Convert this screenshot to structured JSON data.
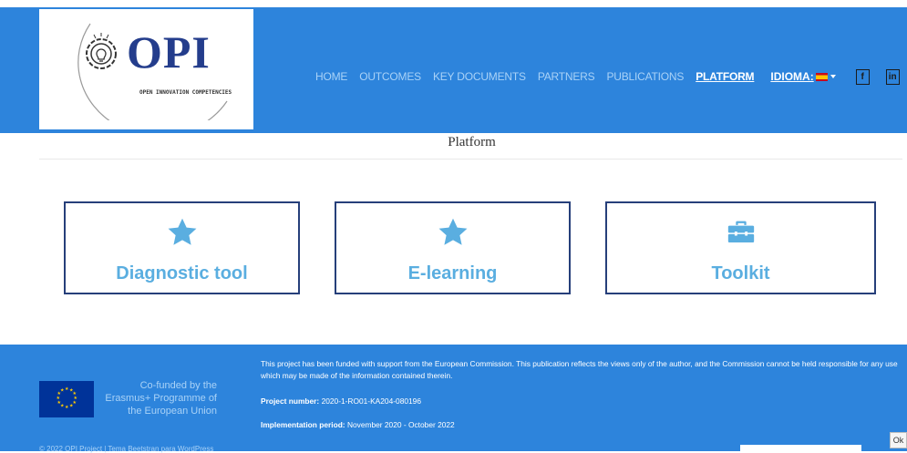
{
  "header": {
    "logo_word": "OPI",
    "logo_subtitle": "OPEN INNOVATION COMPETENCIES",
    "nav": [
      {
        "label": "HOME"
      },
      {
        "label": "OUTCOMES"
      },
      {
        "label": "KEY DOCUMENTS"
      },
      {
        "label": "PARTNERS"
      },
      {
        "label": "PUBLICATIONS"
      },
      {
        "label": "PLATFORM"
      }
    ],
    "language_label": "IDIOMA:",
    "social": {
      "facebook": "f",
      "linkedin": "in"
    }
  },
  "page": {
    "title": "Platform"
  },
  "cards": [
    {
      "label": "Diagnostic tool",
      "icon": "star-icon"
    },
    {
      "label": "E-learning",
      "icon": "star-icon"
    },
    {
      "label": "Toolkit",
      "icon": "toolbox-icon"
    }
  ],
  "footer": {
    "eu_text": "Co-funded by the Erasmus+ Programme of the European Union",
    "funding_text": "This project has been funded with support from the European Commission. This publication reflects the views only of the author, and the Commission cannot be held responsible for any use which may be made of the information contained therein.",
    "project_number_label": "Project number:",
    "project_number_value": "2020-1-RO01-KA204-080196",
    "period_label": "Implementation period:",
    "period_value": "November 2020 - October 2022",
    "copyright": "© 2022 OPI Project | Tema Beetstran para WordPress"
  },
  "corner_button": "Ok",
  "colors": {
    "header_bg": "#2d84dc",
    "card_border": "#263f7a",
    "card_accent": "#5aaee0",
    "nav_inactive": "#a9d2f7"
  }
}
